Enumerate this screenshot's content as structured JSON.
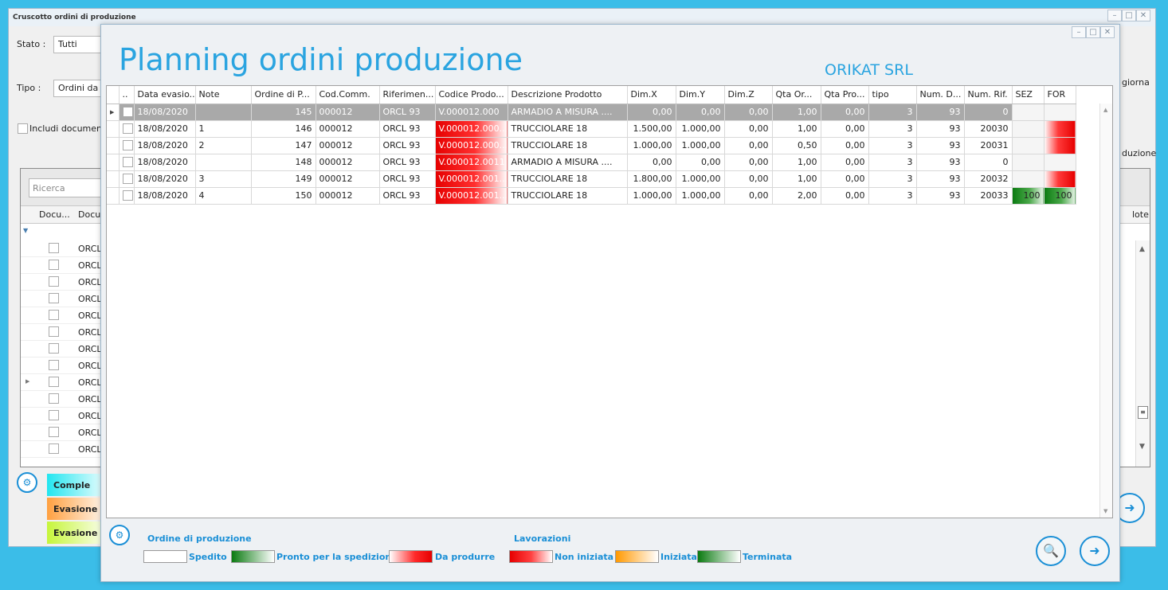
{
  "bg_window": {
    "title": "Cruscotto ordini di produzione",
    "stato_label": "Stato :",
    "stato_value": "Tutti",
    "tipo_label": "Tipo :",
    "tipo_value": "Ordini da",
    "includi_label": "Includi document",
    "aggiorna_partial": "giorna",
    "produzione_partial": "duzione",
    "search_placeholder": "Ricerca",
    "col_docu": "Docu...",
    "col_docum": "Docum",
    "col_note": "lote",
    "rows": [
      "ORCL",
      "ORCL",
      "ORCL",
      "ORCL",
      "ORCL",
      "ORCL",
      "ORCL",
      "ORCL",
      "ORCL",
      "ORCL",
      "ORCL",
      "ORCL",
      "ORCL"
    ],
    "legend": [
      "Comple",
      "Evasione p",
      "Evasione t"
    ],
    "controls": [
      "–",
      "□",
      "✕"
    ]
  },
  "fg_window": {
    "title": "Planning ordini produzione",
    "company": "ORIKAT SRL",
    "controls": [
      "–",
      "□",
      "✕"
    ],
    "columns": [
      "..",
      "Data evasio...",
      "Note",
      "Ordine di P...",
      "Cod.Comm.",
      "Riferimen...",
      "Codice Prodo...",
      "Descrizione Prodotto",
      "Dim.X",
      "Dim.Y",
      "Dim.Z",
      "Qta Or...",
      "Qta Pro...",
      "tipo",
      "Num. D...",
      "Num. Rif.",
      "SEZ",
      "FOR"
    ],
    "rows": [
      {
        "data": "18/08/2020",
        "note": "",
        "ordine": "145",
        "comm": "000012",
        "rif": "ORCL 93",
        "codice": "V.000012.000",
        "descr": "ARMADIO A MISURA ....",
        "dx": "0,00",
        "dy": "0,00",
        "dz": "0,00",
        "qor": "1,00",
        "qpro": "0,00",
        "tipo": "3",
        "numd": "93",
        "numrif": "0",
        "sez": "",
        "for": ""
      },
      {
        "data": "18/08/2020",
        "note": "1",
        "ordine": "146",
        "comm": "000012",
        "rif": "ORCL 93",
        "codice": "V.000012.000...",
        "descr": "TRUCCIOLARE 18",
        "dx": "1.500,00",
        "dy": "1.000,00",
        "dz": "0,00",
        "qor": "1,00",
        "qpro": "0,00",
        "tipo": "3",
        "numd": "93",
        "numrif": "20030",
        "sez": "",
        "for": ""
      },
      {
        "data": "18/08/2020",
        "note": "2",
        "ordine": "147",
        "comm": "000012",
        "rif": "ORCL 93",
        "codice": "V.000012.000...",
        "descr": "TRUCCIOLARE 18",
        "dx": "1.000,00",
        "dy": "1.000,00",
        "dz": "0,00",
        "qor": "0,50",
        "qpro": "0,00",
        "tipo": "3",
        "numd": "93",
        "numrif": "20031",
        "sez": "",
        "for": ""
      },
      {
        "data": "18/08/2020",
        "note": "",
        "ordine": "148",
        "comm": "000012",
        "rif": "ORCL 93",
        "codice": "V.000012.0011",
        "descr": "ARMADIO A MISURA ....",
        "dx": "0,00",
        "dy": "0,00",
        "dz": "0,00",
        "qor": "1,00",
        "qpro": "0,00",
        "tipo": "3",
        "numd": "93",
        "numrif": "0",
        "sez": "",
        "for": ""
      },
      {
        "data": "18/08/2020",
        "note": "3",
        "ordine": "149",
        "comm": "000012",
        "rif": "ORCL 93",
        "codice": "V.000012.001...",
        "descr": "TRUCCIOLARE 18",
        "dx": "1.800,00",
        "dy": "1.000,00",
        "dz": "0,00",
        "qor": "1,00",
        "qpro": "0,00",
        "tipo": "3",
        "numd": "93",
        "numrif": "20032",
        "sez": "",
        "for": ""
      },
      {
        "data": "18/08/2020",
        "note": "4",
        "ordine": "150",
        "comm": "000012",
        "rif": "ORCL 93",
        "codice": "V.000012.001...",
        "descr": "TRUCCIOLARE 18",
        "dx": "1.000,00",
        "dy": "1.000,00",
        "dz": "0,00",
        "qor": "2,00",
        "qpro": "0,00",
        "tipo": "3",
        "numd": "93",
        "numrif": "20033",
        "sez": "100",
        "for": "100"
      }
    ],
    "legend": {
      "ordine_title": "Ordine di produzione",
      "spedito": "Spedito",
      "pronto": "Pronto per la spedizione",
      "da_produrre": "Da produrre",
      "lavorazioni_title": "Lavorazioni",
      "non_iniziata": "Non iniziata",
      "iniziata": "Iniziata",
      "terminata": "Terminata"
    }
  },
  "colors": {
    "accent": "#2aa4e0",
    "red": "#e60000",
    "green": "#0a7a10",
    "orange": "#ff9900",
    "selected_row": "#a9a9a9"
  }
}
